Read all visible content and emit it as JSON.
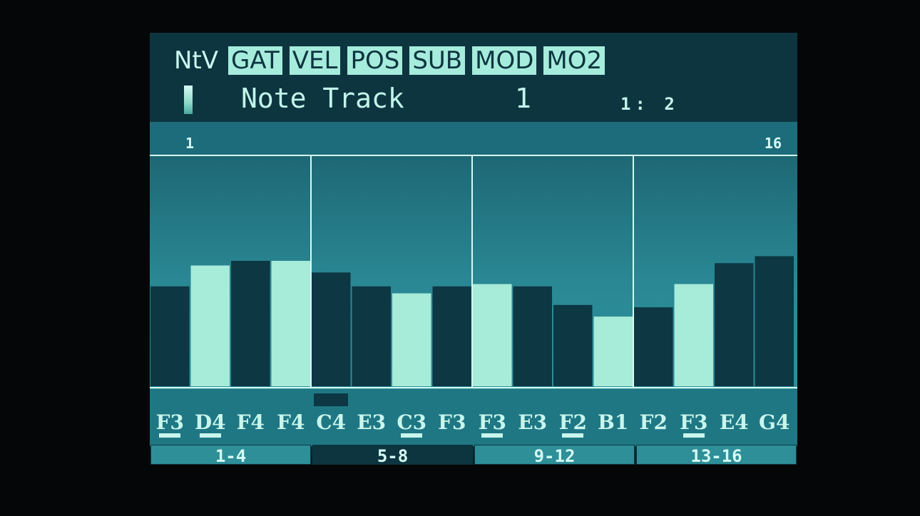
{
  "header": {
    "page_label": "NtV",
    "tabs": [
      "GAT",
      "VEL",
      "POS",
      "SUB",
      "MOD",
      "MO2"
    ]
  },
  "track": {
    "name": "Note Track",
    "number": "1",
    "position": "1: 2"
  },
  "ruler": {
    "start": "1",
    "end": "16"
  },
  "steps": {
    "notes": [
      "F3",
      "D4",
      "F4",
      "F4",
      "C4",
      "E3",
      "C3",
      "F3",
      "F3",
      "E3",
      "F2",
      "B1",
      "F2",
      "F3",
      "E4",
      "G4"
    ],
    "underlined": [
      true,
      true,
      false,
      false,
      false,
      false,
      true,
      false,
      true,
      false,
      true,
      false,
      false,
      true,
      false,
      false
    ],
    "levels": [
      0.43,
      0.52,
      0.54,
      0.54,
      0.49,
      0.43,
      0.4,
      0.43,
      0.44,
      0.43,
      0.35,
      0.3,
      0.34,
      0.44,
      0.53,
      0.56
    ],
    "highlighted": [
      false,
      true,
      false,
      true,
      false,
      false,
      true,
      false,
      true,
      false,
      false,
      true,
      false,
      true,
      false,
      false
    ],
    "selected_step": 4
  },
  "groups": {
    "labels": [
      "1-4",
      "5-8",
      "9-12",
      "13-16"
    ],
    "active_index": 1
  },
  "colors": {
    "bar_light": "#a7ebd9",
    "bar_dark": "#0c3743",
    "grid_line": "#d8fbf4"
  }
}
